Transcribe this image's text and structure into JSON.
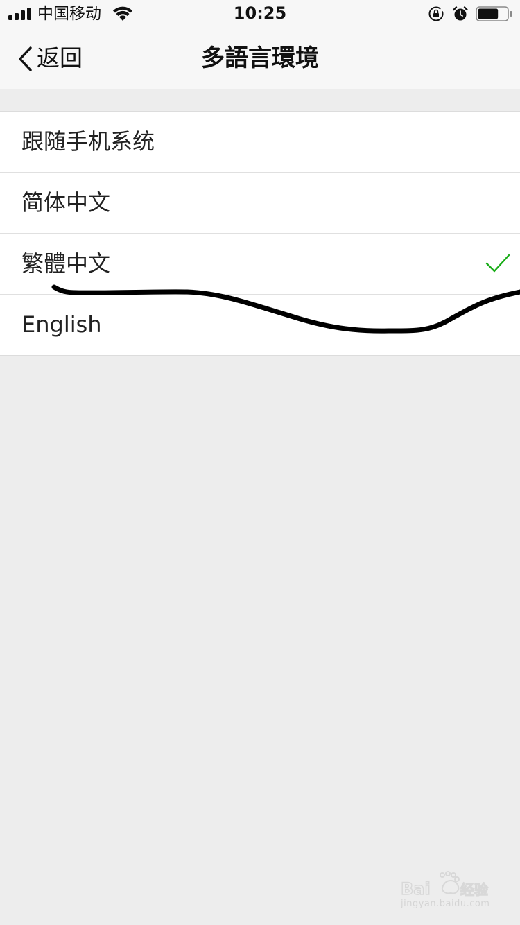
{
  "status_bar": {
    "carrier": "中国移动",
    "time": "10:25",
    "icons": [
      "signal-icon",
      "wifi-icon",
      "rotation-lock-icon",
      "alarm-icon",
      "battery-icon"
    ],
    "battery_level": 0.7
  },
  "nav": {
    "back_label": "返回",
    "title": "多語言環境"
  },
  "languages": {
    "items": [
      {
        "label": "跟随手机系统",
        "selected": false
      },
      {
        "label": "简体中文",
        "selected": false
      },
      {
        "label": "繁體中文",
        "selected": true
      },
      {
        "label": "English",
        "selected": false
      }
    ]
  },
  "watermark": {
    "brand": "Baidu经验",
    "url": "jingyan.baidu.com"
  },
  "colors": {
    "background": "#ededed",
    "list_background": "#ffffff",
    "check_green": "#1aad19",
    "text": "#111111"
  }
}
